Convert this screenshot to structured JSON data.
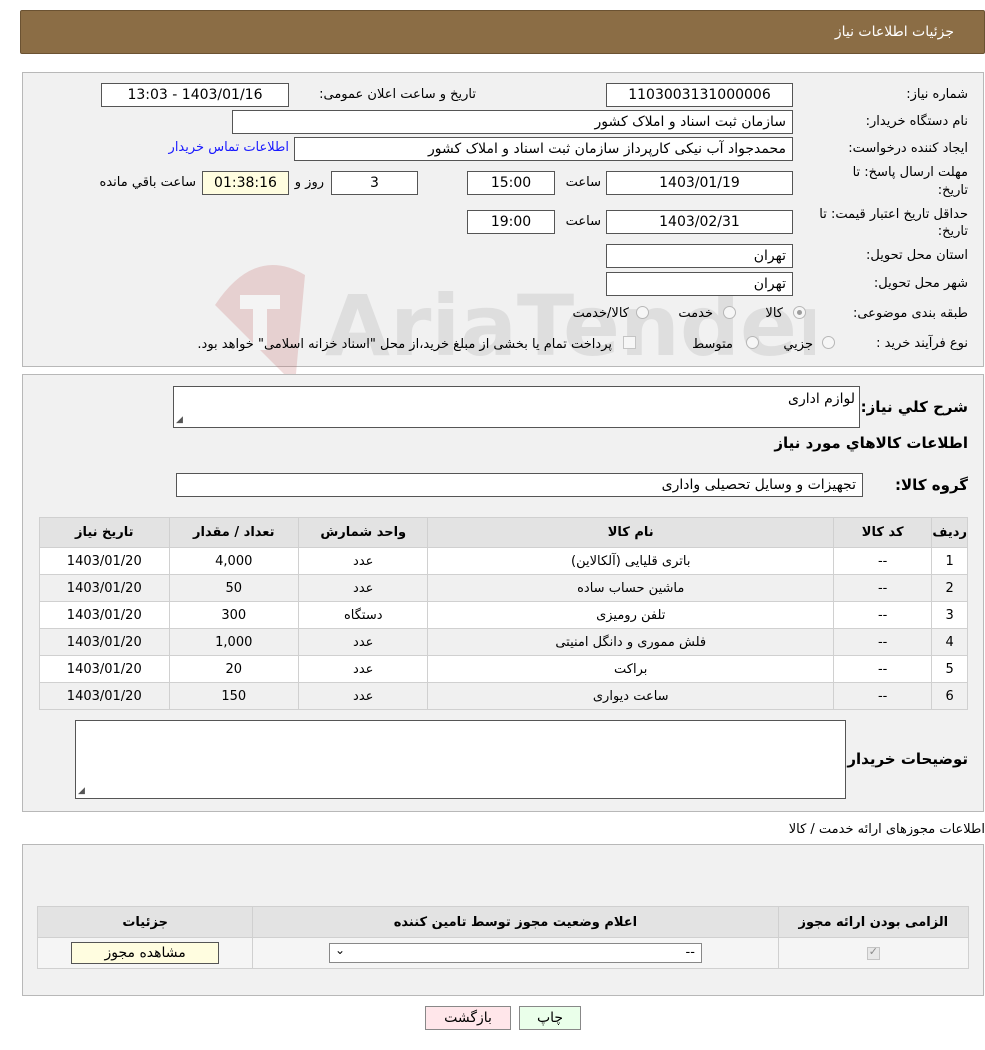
{
  "header": {
    "title": "جزئیات اطلاعات نیاز"
  },
  "form": {
    "need_number_label": "شماره نیاز:",
    "need_number": "1103003131000006",
    "announce_label": "تاریخ و ساعت اعلان عمومی:",
    "announce_value": "1403/01/16 - 13:03",
    "buyer_org_label": "نام دستگاه خريدار:",
    "buyer_org": "سازمان ثبت اسناد و املاک کشور",
    "requester_label": "ایجاد کننده درخواست:",
    "requester": "محمدجواد آب نیکی کارپرداز سازمان ثبت اسناد و املاک کشور",
    "contact_link": "اطلاعات تماس خریدار",
    "deadline_label_1": "مهلت ارسال پاسخ: تا",
    "deadline_label_2": "تاریخ:",
    "deadline_date": "1403/01/19",
    "time_label": "ساعت",
    "deadline_time": "15:00",
    "days_value": "3",
    "days_label": "روز و",
    "remaining_value": "01:38:16",
    "remaining_label": "ساعت باقي مانده",
    "validity_label_1": "حداقل تاریخ اعتبار قیمت: تا",
    "validity_label_2": "تاریخ:",
    "validity_date": "1403/02/31",
    "validity_time": "19:00",
    "province_label": "استان محل تحویل:",
    "province": "تهران",
    "city_label": "شهر محل تحویل:",
    "city": "تهران",
    "category_label": "طبقه بندی موضوعی:",
    "category_options": [
      "كالا",
      "خدمت",
      "کالا/خدمت"
    ],
    "purchase_type_label": "نوع فرآیند خرید :",
    "purchase_options": [
      "جزيي",
      "متوسط"
    ],
    "payment_note": "پرداخت تمام یا بخشی از مبلغ خرید،از محل \"اسناد خزانه اسلامی\" خواهد بود."
  },
  "details": {
    "description_label": "شرح كلي نياز:",
    "description": "لوازم اداری",
    "goods_info_title": "اطلاعات كالاهاي مورد نياز",
    "group_label": "گروه كالا:",
    "group_value": "تجهیزات و وسایل تحصیلی واداری",
    "columns": [
      "رديف",
      "كد كالا",
      "نام كالا",
      "واحد شمارش",
      "تعداد / مقدار",
      "تاريخ نياز"
    ],
    "rows": [
      [
        "1",
        "--",
        "باتری قلیایی (آلکالاین)",
        "عدد",
        "4,000",
        "1403/01/20"
      ],
      [
        "2",
        "--",
        "ماشین حساب ساده",
        "عدد",
        "50",
        "1403/01/20"
      ],
      [
        "3",
        "--",
        "تلفن رومیزی",
        "دستگاه",
        "300",
        "1403/01/20"
      ],
      [
        "4",
        "--",
        "فلش مموری و دانگل امنیتی",
        "عدد",
        "1,000",
        "1403/01/20"
      ],
      [
        "5",
        "--",
        "براکت",
        "عدد",
        "20",
        "1403/01/20"
      ],
      [
        "6",
        "--",
        "ساعت دیواری",
        "عدد",
        "150",
        "1403/01/20"
      ]
    ],
    "buyer_notes_label": "توضيحات خريدار:"
  },
  "license": {
    "section_title": "اطلاعات مجوزهای ارائه خدمت / کالا",
    "col_required": "الزامی بودن ارائه مجوز",
    "col_status": "اعلام وضعیت مجوز توسط تامین کننده",
    "col_details": "جزئیات",
    "status_value": "--",
    "view_button": "مشاهده مجوز"
  },
  "buttons": {
    "print": "چاپ",
    "back": "بازگشت"
  },
  "colors": {
    "header": "#8b6d45",
    "print_btn": "#eaffea",
    "back_btn": "#ffe6ea"
  }
}
